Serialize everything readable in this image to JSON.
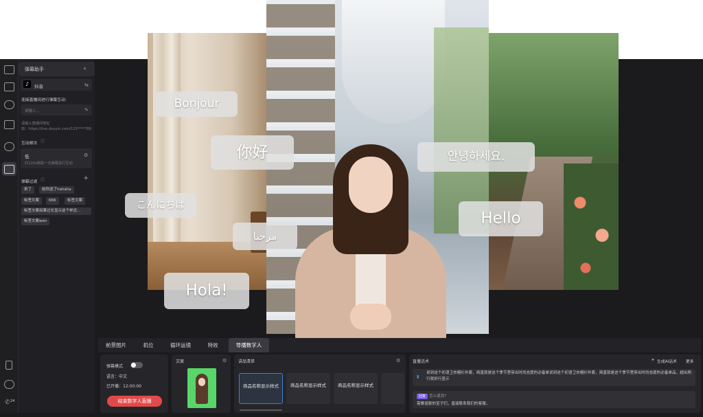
{
  "sidebar": {
    "title": "弹幕助手",
    "platform": "抖音",
    "connect_label": "连接直播间进行弹幕互动:",
    "input_placeholder": "请输入...",
    "input_hint": "请输入直播间地址",
    "input_example": "如：https://live.douyin.com/123****789",
    "frequency_label": "互动频次",
    "frequency_value": "低",
    "frequency_desc": "约120s获取一次弹幕进行互动",
    "filter_label": "弹幕过滤",
    "filter_tags": [
      "来了",
      "给你送了hahaha",
      "标签文案",
      "666",
      "标签文案",
      "标签文案如果过长显示这个样式...",
      "标签文案wen"
    ]
  },
  "danmaku": {
    "bonjour": "Bonjour",
    "nihao": "你好",
    "konnichiwa": "こんにちは",
    "marhaba": "مرحبا",
    "hola": "Hola!",
    "annyeong": "안녕하세요.",
    "hello": "Hello"
  },
  "tabs": {
    "items": [
      "前景图片",
      "机位",
      "循环运镜",
      "特效",
      "导播数字人"
    ],
    "active": "导播数字人"
  },
  "bottom": {
    "danmaku_mode_label": "弹幕模式",
    "language": "语言：中文",
    "started": "已开播：12:00:00",
    "end_button": "结束数字人直播",
    "doc_title": "文案",
    "goods_title": "讲品清单",
    "goods_items": [
      "商品名称显示样式",
      "商品名称显示样式",
      "商品名称显示样式"
    ],
    "script_title": "直播话术",
    "generate_ai": "生成AI话术",
    "more": "更多",
    "script_text": "说到这个初语卫衣帽衫外套，简直就是这个季节里穿出时尚态度的必备单说到这个初语卫衣帽衫外套，简直就是这个季节里穿出时尚态度的必备单品，超出两行就折行显示",
    "reply_badge": "回复",
    "reply_question": "怎么退货?",
    "reply_answer": "需要退款的宝子们，直接联系我们的客服。"
  },
  "colors": {
    "accent_blue": "#3f7fd6",
    "end_red": "#e24a4a",
    "badge_purple": "#7b5be0"
  }
}
